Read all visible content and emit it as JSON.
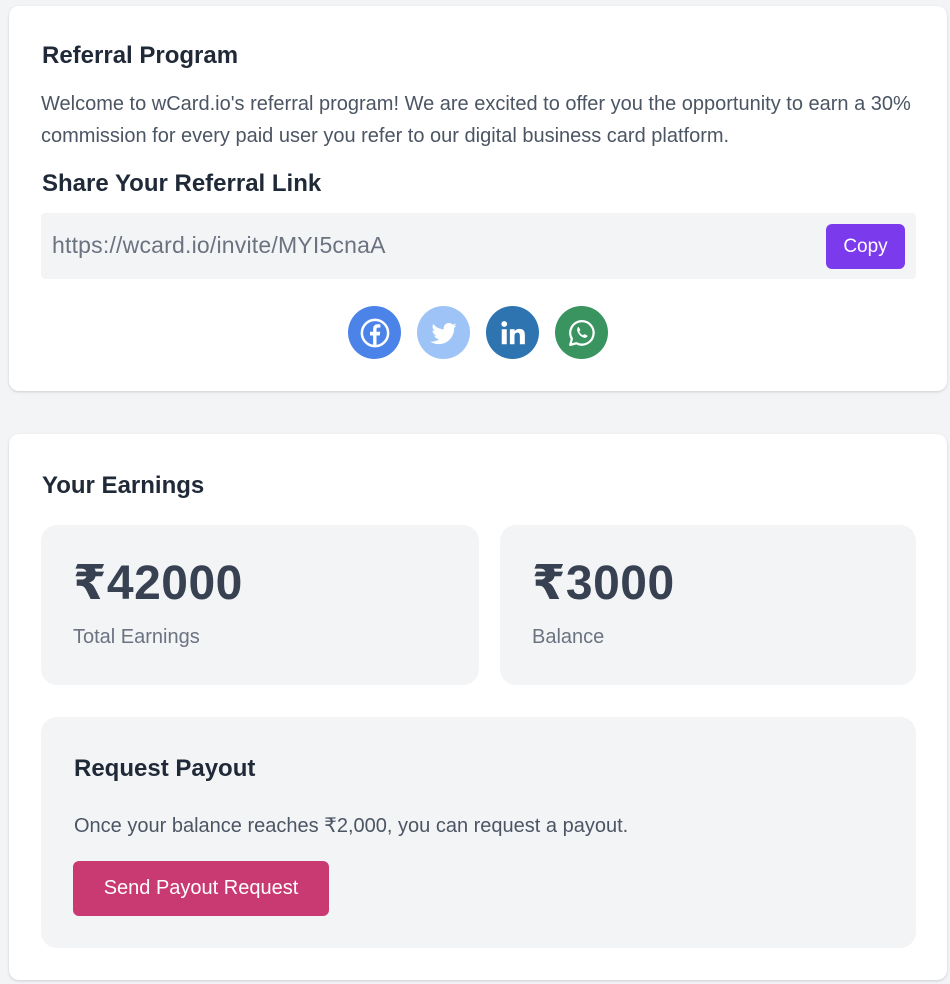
{
  "referral": {
    "title": "Referral Program",
    "intro": "Welcome to wCard.io's referral program! We are excited to offer you the opportunity to earn a 30% commission for every paid user you refer to our digital business card platform.",
    "share_title": "Share Your Referral Link",
    "link": "https://wcard.io/invite/MYI5cnaA",
    "copy_label": "Copy",
    "socials": [
      {
        "icon": "facebook-icon",
        "color": "#4c83e8"
      },
      {
        "icon": "twitter-icon",
        "color": "#9dc3f7"
      },
      {
        "icon": "linkedin-icon",
        "color": "#2e74b0"
      },
      {
        "icon": "whatsapp-icon",
        "color": "#3a9460"
      }
    ]
  },
  "earnings": {
    "title": "Your Earnings",
    "total_value": "₹42000",
    "total_label": "Total Earnings",
    "balance_value": "₹3000",
    "balance_label": "Balance"
  },
  "payout": {
    "title": "Request Payout",
    "description": "Once your balance reaches ₹2,000, you can request a payout.",
    "button_label": "Send Payout Request"
  },
  "colors": {
    "accent": "#7c3aed",
    "payout_button": "#c93a72",
    "background": "#f3f4f6"
  }
}
